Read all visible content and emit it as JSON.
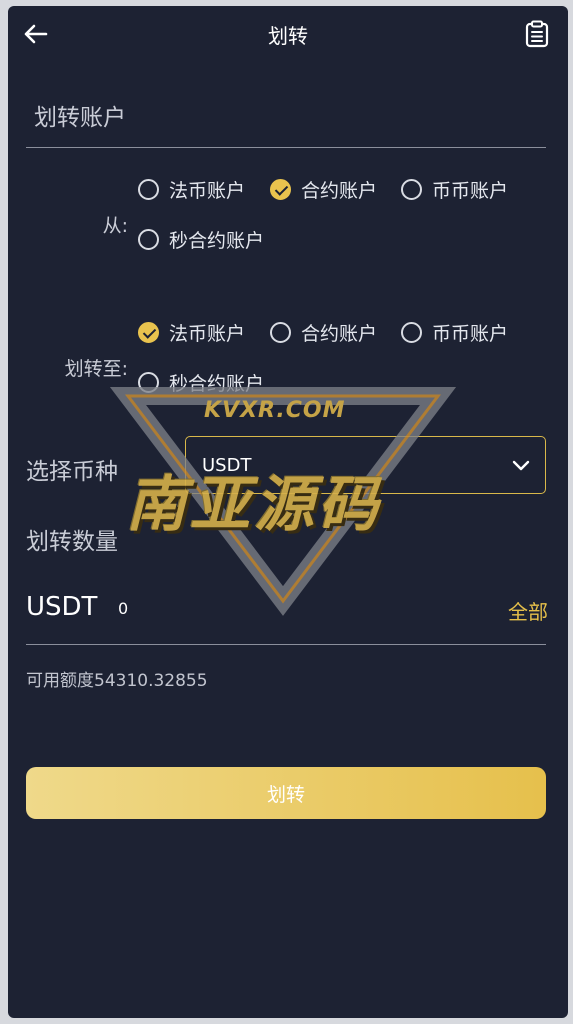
{
  "header": {
    "title": "划转"
  },
  "account_section": {
    "title": "划转账户"
  },
  "from": {
    "label": "从:",
    "options": [
      {
        "label": "法币账户",
        "checked": false
      },
      {
        "label": "合约账户",
        "checked": true
      },
      {
        "label": "币币账户",
        "checked": false
      },
      {
        "label": "秒合约账户",
        "checked": false
      }
    ]
  },
  "to": {
    "label": "划转至:",
    "options": [
      {
        "label": "法币账户",
        "checked": true
      },
      {
        "label": "合约账户",
        "checked": false
      },
      {
        "label": "币币账户",
        "checked": false
      },
      {
        "label": "秒合约账户",
        "checked": false
      }
    ]
  },
  "currency": {
    "label": "选择币种",
    "selected": "USDT"
  },
  "amount": {
    "label": "划转数量",
    "unit": "USDT",
    "value": "0",
    "all_label": "全部"
  },
  "available": {
    "text": "可用额度54310.32855"
  },
  "submit": {
    "label": "划转"
  },
  "watermark": {
    "url": "KVXR.COM",
    "brand": "南亚源码"
  },
  "colors": {
    "background": "#1d2233",
    "accent": "#e9c34e",
    "text": "#dfe3ec"
  }
}
